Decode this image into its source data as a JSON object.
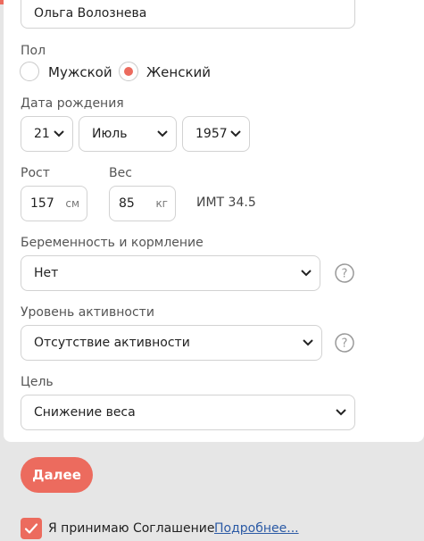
{
  "form": {
    "name_value": "Ольга Волознева",
    "sex_label": "Пол",
    "sex_options": [
      "Мужской",
      "Женский"
    ],
    "sex_selected": "Женский",
    "birth_label": "Дата рождения",
    "birth_day": "21",
    "birth_month": "Июль",
    "birth_year": "1957",
    "height_label": "Рост",
    "height_value": "157",
    "height_unit": "см",
    "weight_label": "Вес",
    "weight_value": "85",
    "weight_unit": "кг",
    "bmi_text": "ИМТ 34.5",
    "pregnancy_label": "Беременность и кормление",
    "pregnancy_value": "Нет",
    "activity_label": "Уровень активности",
    "activity_value": "Отсутствие активности",
    "goal_label": "Цель",
    "goal_value": "Снижение веса"
  },
  "footer": {
    "next_button": "Далее",
    "agree_text": "Я принимаю Соглашение",
    "more_link": "Подробнее...",
    "agreed": true
  },
  "colors": {
    "accent": "#ec6b5e",
    "link": "#2b5aa5"
  }
}
